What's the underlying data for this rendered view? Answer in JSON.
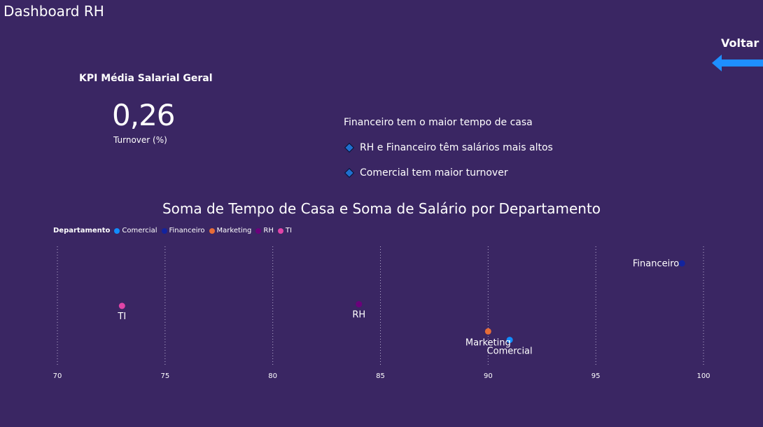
{
  "header": {
    "title": "Dashboard RH",
    "back_label": "Voltar",
    "back_color": "#1e8fff"
  },
  "kpi": {
    "title": "KPI Média Salarial Geral",
    "value": "0,26",
    "subtitle": "Turnover (%)"
  },
  "insights": {
    "heading": "Financeiro tem o maior tempo de casa",
    "items": [
      "RH e Financeiro têm salários mais altos",
      "Comercial tem maior turnover"
    ]
  },
  "chart_data": {
    "type": "scatter",
    "title": "Soma de Tempo de Casa e Soma de Salário por Departamento",
    "legend_title": "Departamento",
    "legend_position": "top-left",
    "xlim": [
      70,
      100
    ],
    "xticks": [
      "70",
      "75",
      "80",
      "85",
      "90",
      "95",
      "100"
    ],
    "grid": "vertical-dotted",
    "series": [
      {
        "name": "Comercial",
        "color": "#118dff",
        "x": 91,
        "y": 3
      },
      {
        "name": "Financeiro",
        "color": "#12239e",
        "x": 99,
        "y": 12
      },
      {
        "name": "Marketing",
        "color": "#e66c37",
        "x": 90,
        "y": 4
      },
      {
        "name": "RH",
        "color": "#6b007b",
        "x": 84,
        "y": 7.2
      },
      {
        "name": "TI",
        "color": "#e044a7",
        "x": 73,
        "y": 7
      }
    ]
  }
}
